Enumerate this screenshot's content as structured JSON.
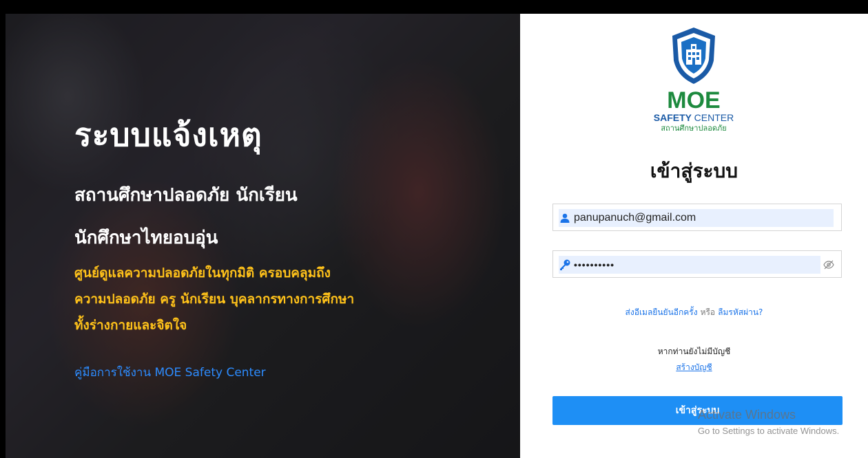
{
  "hero": {
    "title": "ระบบแจ้งเหตุ",
    "subtitle_line1": "สถานศึกษาปลอดภัย นักเรียน",
    "subtitle_line2": "นักศึกษาไทยอบอุ่น",
    "desc_line1": "ศูนย์ดูแลความปลอดภัยในทุกมิติ ครอบคลุมถึง",
    "desc_line2": "ความปลอดภัย ครู นักเรียน บุคลากรทางการศึกษา",
    "desc_line3": "ทั้งร่างกายและจิตใจ",
    "manual_link": "คู่มือการใช้งาน MOE Safety Center"
  },
  "logo": {
    "moe": "MOE",
    "safety": "SAFETY",
    "center": "CENTER",
    "thai": "สถานศึกษาปลอดภัย"
  },
  "login": {
    "title": "เข้าสู่ระบบ",
    "email_value": "panupanuch@gmail.com",
    "password_value": "••••••••••",
    "resend_link": "ส่งอีเมลยืนยันอีกครั้ง",
    "or_text": "หรือ",
    "forgot_link": "ลืมรหัสผ่าน?",
    "no_account_text": "หากท่านยังไม่มีบัญชี",
    "create_account_link": "สร้างบัญชี",
    "submit_label": "เข้าสู่ระบบ"
  },
  "watermark": {
    "line1": "Activate Windows",
    "line2": "Go to Settings to activate Windows."
  },
  "colors": {
    "accent": "#1e8ff5",
    "link": "#1a73e8",
    "hero_highlight": "#ffc21a",
    "brand_green": "#1d8a3e",
    "brand_blue": "#1a5aa6"
  },
  "icons": {
    "email": "user-icon",
    "password": "key-icon",
    "toggle": "eye-slash-icon",
    "logo": "shield-school-icon"
  }
}
